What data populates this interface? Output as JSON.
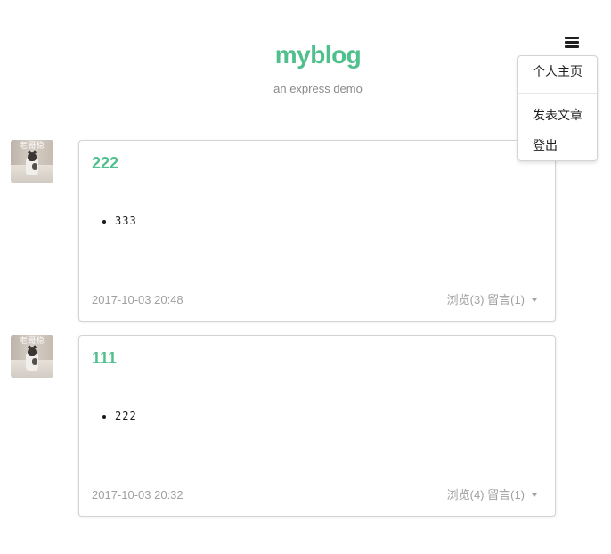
{
  "header": {
    "title": "myblog",
    "subtitle": "an express demo"
  },
  "menu": {
    "icon": "hamburger-menu-icon",
    "items": {
      "home": "个人主页",
      "write": "发表文章",
      "logout": "登出"
    }
  },
  "posts": [
    {
      "avatar_watermark": "老哥稳",
      "title": "222",
      "content": [
        "333"
      ],
      "date": "2017-10-03 20:48",
      "stats": "浏览(3) 留言(1)"
    },
    {
      "avatar_watermark": "老哥稳",
      "title": "111",
      "content": [
        "222"
      ],
      "date": "2017-10-03 20:32",
      "stats": "浏览(4) 留言(1)"
    }
  ],
  "colors": {
    "accent": "#4fc08d",
    "muted": "#a0a0a0",
    "border": "#d4d4d5"
  }
}
